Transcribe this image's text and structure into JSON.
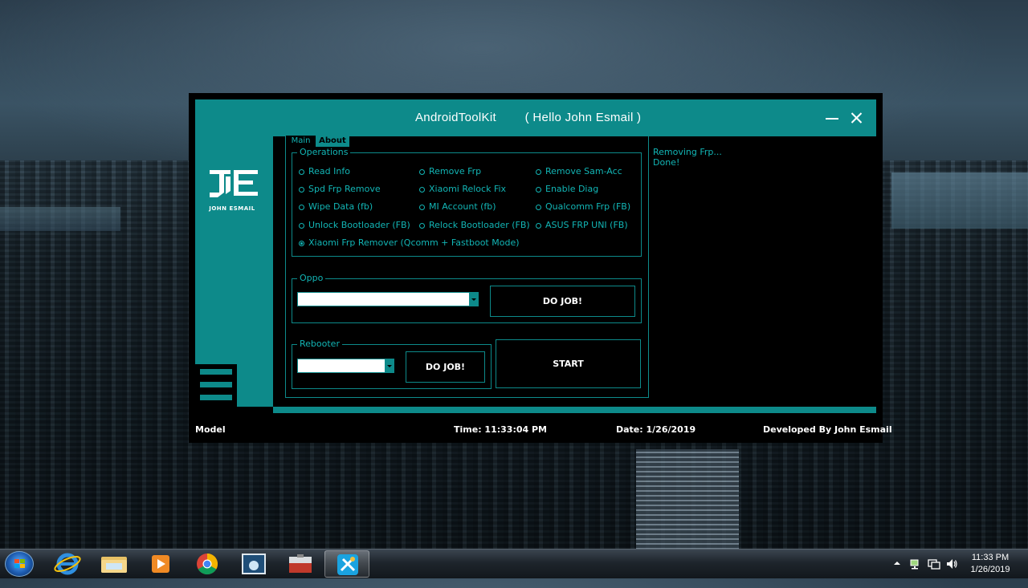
{
  "window": {
    "title": "AndroidToolKit        ( Hello John Esmail )",
    "logo_caption": "JOHN ESMAIL"
  },
  "tabs": [
    {
      "label": "Main",
      "active": true
    },
    {
      "label": "About",
      "active": false
    }
  ],
  "operations": {
    "label": "Operations",
    "options": [
      {
        "label": "Read Info",
        "checked": false
      },
      {
        "label": "Remove Frp",
        "checked": false
      },
      {
        "label": "Remove Sam-Acc",
        "checked": false
      },
      {
        "label": "Spd Frp Remove",
        "checked": false
      },
      {
        "label": "Xiaomi Relock Fix",
        "checked": false
      },
      {
        "label": "Enable Diag",
        "checked": false
      },
      {
        "label": "Wipe Data (fb)",
        "checked": false
      },
      {
        "label": "MI Account (fb)",
        "checked": false
      },
      {
        "label": "Qualcomm Frp (FB)",
        "checked": false
      },
      {
        "label": "Unlock Bootloader (FB)",
        "checked": false
      },
      {
        "label": "Relock Bootloader (FB)",
        "checked": false
      },
      {
        "label": "ASUS FRP UNI (FB)",
        "checked": false
      },
      {
        "label": "Xiaomi Frp Remover (Qcomm + Fastboot Mode)",
        "checked": true
      }
    ]
  },
  "oppo": {
    "label": "Oppo",
    "selected": "",
    "button": "DO JOB!"
  },
  "rebooter": {
    "label": "Rebooter",
    "selected": "",
    "button": "DO JOB!"
  },
  "start_button": "START",
  "log": [
    "Removing Frp...",
    "Done!"
  ],
  "statusbar": {
    "model": "Model",
    "time": "Time: 11:33:04 PM",
    "date": "Date: 1/26/2019",
    "developer": "Developed By John Esmail"
  },
  "taskbar": {
    "clock_time": "11:33 PM",
    "clock_date": "1/26/2019",
    "items": [
      {
        "icon": "internet-explorer-icon"
      },
      {
        "icon": "file-explorer-icon"
      },
      {
        "icon": "media-player-icon"
      },
      {
        "icon": "chrome-icon"
      },
      {
        "icon": "app-logo-icon"
      },
      {
        "icon": "toolbox-icon"
      },
      {
        "icon": "tool-app-icon",
        "active": true
      }
    ]
  },
  "colors": {
    "accent": "#0d8a8a",
    "text_accent": "#12b5b5",
    "background": "#000000"
  }
}
